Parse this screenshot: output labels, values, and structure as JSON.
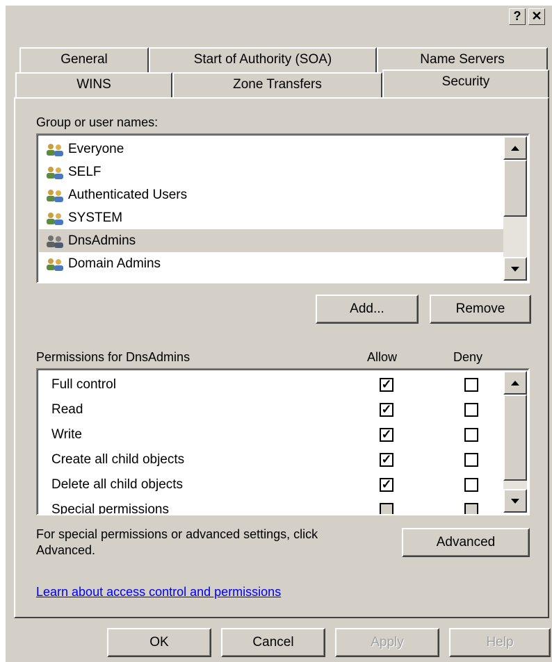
{
  "titlebar": {
    "help_label": "?",
    "close_label": "✕"
  },
  "tabs_back": [
    {
      "label": "General"
    },
    {
      "label": "Start of Authority (SOA)"
    },
    {
      "label": "Name Servers"
    }
  ],
  "tabs_front": [
    {
      "label": "WINS"
    },
    {
      "label": "Zone Transfers"
    },
    {
      "label": "Security"
    }
  ],
  "group_label": "Group or user names:",
  "users": [
    {
      "name": "Everyone",
      "icon": "user-group-icon"
    },
    {
      "name": "SELF",
      "icon": "user-group-icon"
    },
    {
      "name": "Authenticated Users",
      "icon": "user-group-icon"
    },
    {
      "name": "SYSTEM",
      "icon": "user-group-icon"
    },
    {
      "name": "DnsAdmins",
      "icon": "user-group-icon",
      "selected": true
    },
    {
      "name": "Domain Admins",
      "icon": "user-group-icon"
    }
  ],
  "add_button": "Add...",
  "remove_button": "Remove",
  "permissions_label": "Permissions for DnsAdmins",
  "allow_header": "Allow",
  "deny_header": "Deny",
  "permissions": [
    {
      "name": "Full control",
      "allow": "☑",
      "deny": "☐"
    },
    {
      "name": "Read",
      "allow": "☑",
      "deny": "☐"
    },
    {
      "name": "Write",
      "allow": "☑",
      "deny": "☐"
    },
    {
      "name": "Create all child objects",
      "allow": "☑",
      "deny": "☐"
    },
    {
      "name": "Delete all child objects",
      "allow": "☑",
      "deny": "☐"
    },
    {
      "name": "Special permissions",
      "allow": "☐",
      "deny": "☐"
    }
  ],
  "advanced_text": "For special permissions or advanced settings, click Advanced.",
  "advanced_button": "Advanced",
  "learn_link": "Learn about access control and permissions",
  "footer": {
    "ok": "OK",
    "cancel": "Cancel",
    "apply": "Apply",
    "help": "Help"
  },
  "colors": {
    "face": "#d4d0c8",
    "selection": "#d4d0c8",
    "link": "#0000ee"
  }
}
